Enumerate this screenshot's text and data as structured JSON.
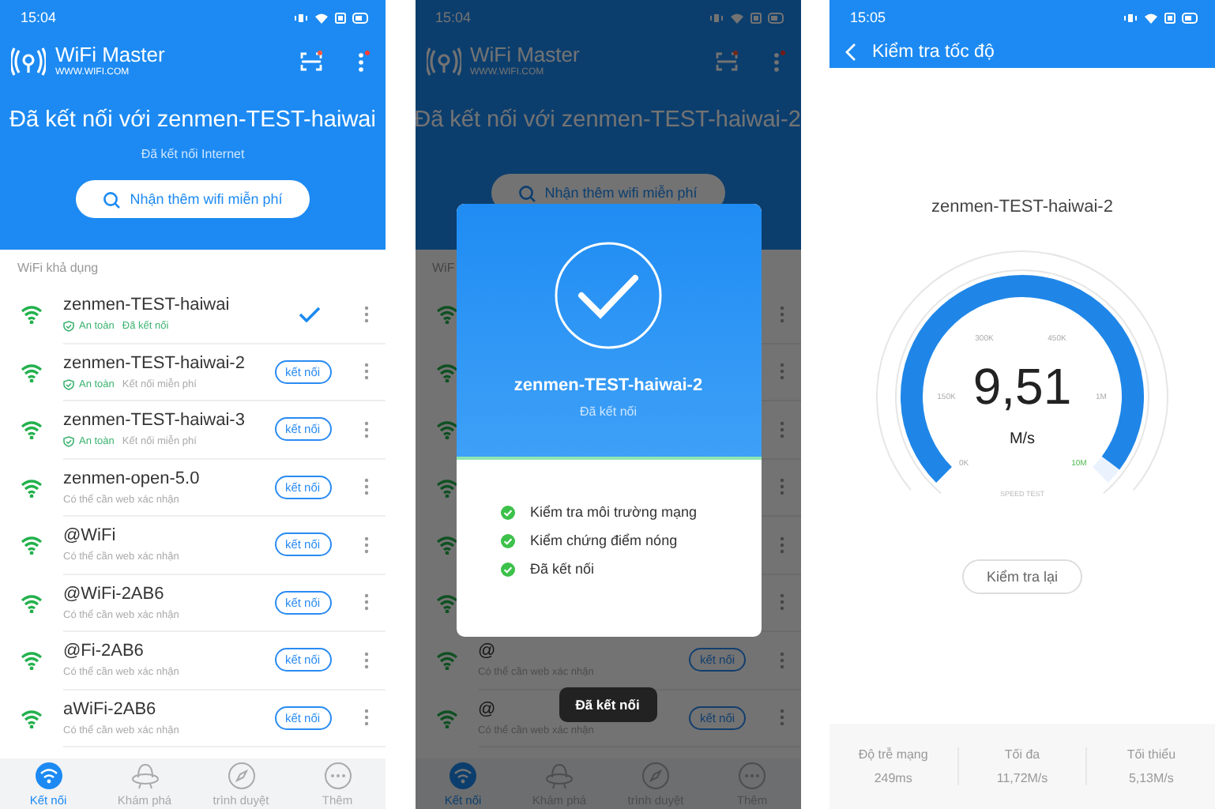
{
  "screens": [
    {
      "kind": "wifi_list",
      "status_time": "15:04",
      "app_title": "WiFi Master",
      "app_url": "WWW.WIFI.COM",
      "connected_title": "Đã kết nối với zenmen-TEST-haiwai",
      "connected_subtitle": "Đã kết nối Internet",
      "free_wifi_button": "Nhận thêm wifi miễn phí",
      "section_label": "WiFi khả dụng",
      "networks": [
        {
          "kind": "connected",
          "name": "zenmen-TEST-haiwai",
          "secure_label": "An toàn",
          "status": "Đã kết nối"
        },
        {
          "kind": "available",
          "name": "zenmen-TEST-haiwai-2",
          "secure_label": "An toàn",
          "status": "Kết nối miễn phí",
          "button": "kết nối"
        },
        {
          "kind": "available",
          "name": "zenmen-TEST-haiwai-3",
          "secure_label": "An toàn",
          "status": "Kết nối miễn phí",
          "button": "kết nối"
        },
        {
          "kind": "available",
          "name": "zenmen-open-5.0",
          "status": "Có thể cần web xác nhận",
          "button": "kết nối"
        },
        {
          "kind": "available",
          "name": "@WiFi",
          "status": "Có thể cần web xác nhận",
          "button": "kết nối"
        },
        {
          "kind": "available",
          "name": "@WiFi-2AB6",
          "status": "Có thể cần web xác nhận",
          "button": "kết nối"
        },
        {
          "kind": "available",
          "name": "@Fi-2AB6",
          "status": "Có thể cần web xác nhận",
          "button": "kết nối"
        },
        {
          "kind": "available",
          "name": "aWiFi-2AB6",
          "status": "Có thể cần web xác nhận",
          "button": "kết nối"
        }
      ],
      "nav": [
        {
          "label": "Kết nối",
          "selected": true
        },
        {
          "label": "Khám phá",
          "selected": false
        },
        {
          "label": "trình duyệt",
          "selected": false
        },
        {
          "label": "Thêm",
          "selected": false
        }
      ]
    },
    {
      "kind": "wifi_list_dialog",
      "status_time": "15:04",
      "app_title": "WiFi Master",
      "app_url": "WWW.WIFI.COM",
      "connected_title": "Đã kết nối với zenmen-TEST-haiwai-2",
      "free_wifi_button": "Nhận thêm wifi miễn phí",
      "section_label": "WiF",
      "networks": [
        {
          "kind": "covered"
        },
        {
          "kind": "covered"
        },
        {
          "kind": "covered"
        },
        {
          "kind": "covered"
        },
        {
          "kind": "covered"
        },
        {
          "kind": "covered"
        },
        {
          "kind": "available",
          "name": "@",
          "status": "Có thể cần web xác nhận",
          "button": "kết nối"
        },
        {
          "kind": "available",
          "name": "@",
          "status": "Có thể cần web xác nhận",
          "button": "kết nối"
        }
      ],
      "nav": [
        {
          "label": "Kết nối",
          "selected": true
        },
        {
          "label": "Khám phá",
          "selected": false
        },
        {
          "label": "trình duyệt",
          "selected": false
        },
        {
          "label": "Thêm",
          "selected": false
        }
      ],
      "dialog": {
        "network": "zenmen-TEST-haiwai-2",
        "status": "Đã kết nối",
        "checks": [
          {
            "label": "Kiểm tra môi trường mạng",
            "done": true
          },
          {
            "label": "Kiểm chứng điểm nóng",
            "done": true
          },
          {
            "label": "Đã kết nối",
            "done": true
          }
        ]
      },
      "toast": "Đã kết nối"
    },
    {
      "kind": "speed_test",
      "status_time": "15:05",
      "title": "Kiểm tra tốc độ",
      "network": "zenmen-TEST-haiwai-2",
      "gauge": {
        "level": 0.97,
        "reading": "9,51",
        "unit": "M/s",
        "ticks": [
          "0K",
          "150K",
          "300K",
          "450K",
          "1M",
          "10M"
        ],
        "caption": "SPEED TEST"
      },
      "retest_button": "Kiểm tra lại",
      "stats": [
        {
          "label": "Độ trễ mạng",
          "value": "249ms"
        },
        {
          "label": "Tối đa",
          "value": "11,72M/s"
        },
        {
          "label": "Tối thiểu",
          "value": "5,13M/s"
        }
      ]
    }
  ]
}
